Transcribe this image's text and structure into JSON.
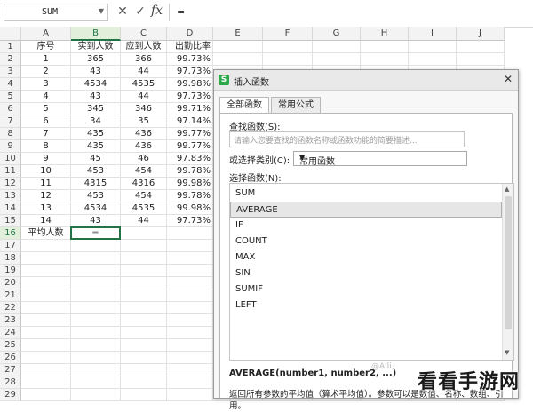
{
  "formula_bar": {
    "name_box": "SUM",
    "cancel_icon": "✕",
    "enter_icon": "✓",
    "fx_label": "fx",
    "content": "="
  },
  "columns": [
    "A",
    "B",
    "C",
    "D",
    "E",
    "F",
    "G",
    "H",
    "I",
    "J"
  ],
  "rows": [
    "1",
    "2",
    "3",
    "4",
    "5",
    "6",
    "7",
    "8",
    "9",
    "10",
    "11",
    "12",
    "13",
    "14",
    "15",
    "16",
    "17",
    "18",
    "19",
    "20",
    "21",
    "22",
    "23",
    "24",
    "25",
    "26",
    "27",
    "28",
    "29"
  ],
  "table": {
    "headers": [
      "序号",
      "实到人数",
      "应到人数",
      "出勤比率"
    ],
    "data": [
      [
        "1",
        "365",
        "366",
        "99.73%"
      ],
      [
        "2",
        "43",
        "44",
        "97.73%"
      ],
      [
        "3",
        "4534",
        "4535",
        "99.98%"
      ],
      [
        "4",
        "43",
        "44",
        "97.73%"
      ],
      [
        "5",
        "345",
        "346",
        "99.71%"
      ],
      [
        "6",
        "34",
        "35",
        "97.14%"
      ],
      [
        "7",
        "435",
        "436",
        "99.77%"
      ],
      [
        "8",
        "435",
        "436",
        "99.77%"
      ],
      [
        "9",
        "45",
        "46",
        "97.83%"
      ],
      [
        "10",
        "453",
        "454",
        "99.78%"
      ],
      [
        "11",
        "4315",
        "4316",
        "99.98%"
      ],
      [
        "12",
        "453",
        "454",
        "99.78%"
      ],
      [
        "13",
        "4534",
        "4535",
        "99.98%"
      ],
      [
        "14",
        "43",
        "44",
        "97.73%"
      ]
    ],
    "avg_label": "平均人数",
    "avg_formula": "="
  },
  "dialog": {
    "title": "插入函数",
    "logo": "S",
    "close": "✕",
    "tabs": [
      "全部函数",
      "常用公式"
    ],
    "search_label": "查找函数(S):",
    "search_placeholder": "请输入您要查找的函数名称或函数功能的简要描述...",
    "category_label": "或选择类别(C):",
    "category_value": "常用函数",
    "list_label": "选择函数(N):",
    "functions": [
      "SUM",
      "AVERAGE",
      "IF",
      "COUNT",
      "MAX",
      "SIN",
      "SUMIF",
      "LEFT"
    ],
    "selected_function": "AVERAGE",
    "signature": "AVERAGE(number1, number2, ...)",
    "description": "返回所有参数的平均值（算术平均值）。参数可以是数值、名称、数组、引用。"
  },
  "watermark": "@Alli",
  "brand": "看看手游网",
  "colors": {
    "accent_green": "#217346",
    "header_bg": "#f3f3f3"
  }
}
